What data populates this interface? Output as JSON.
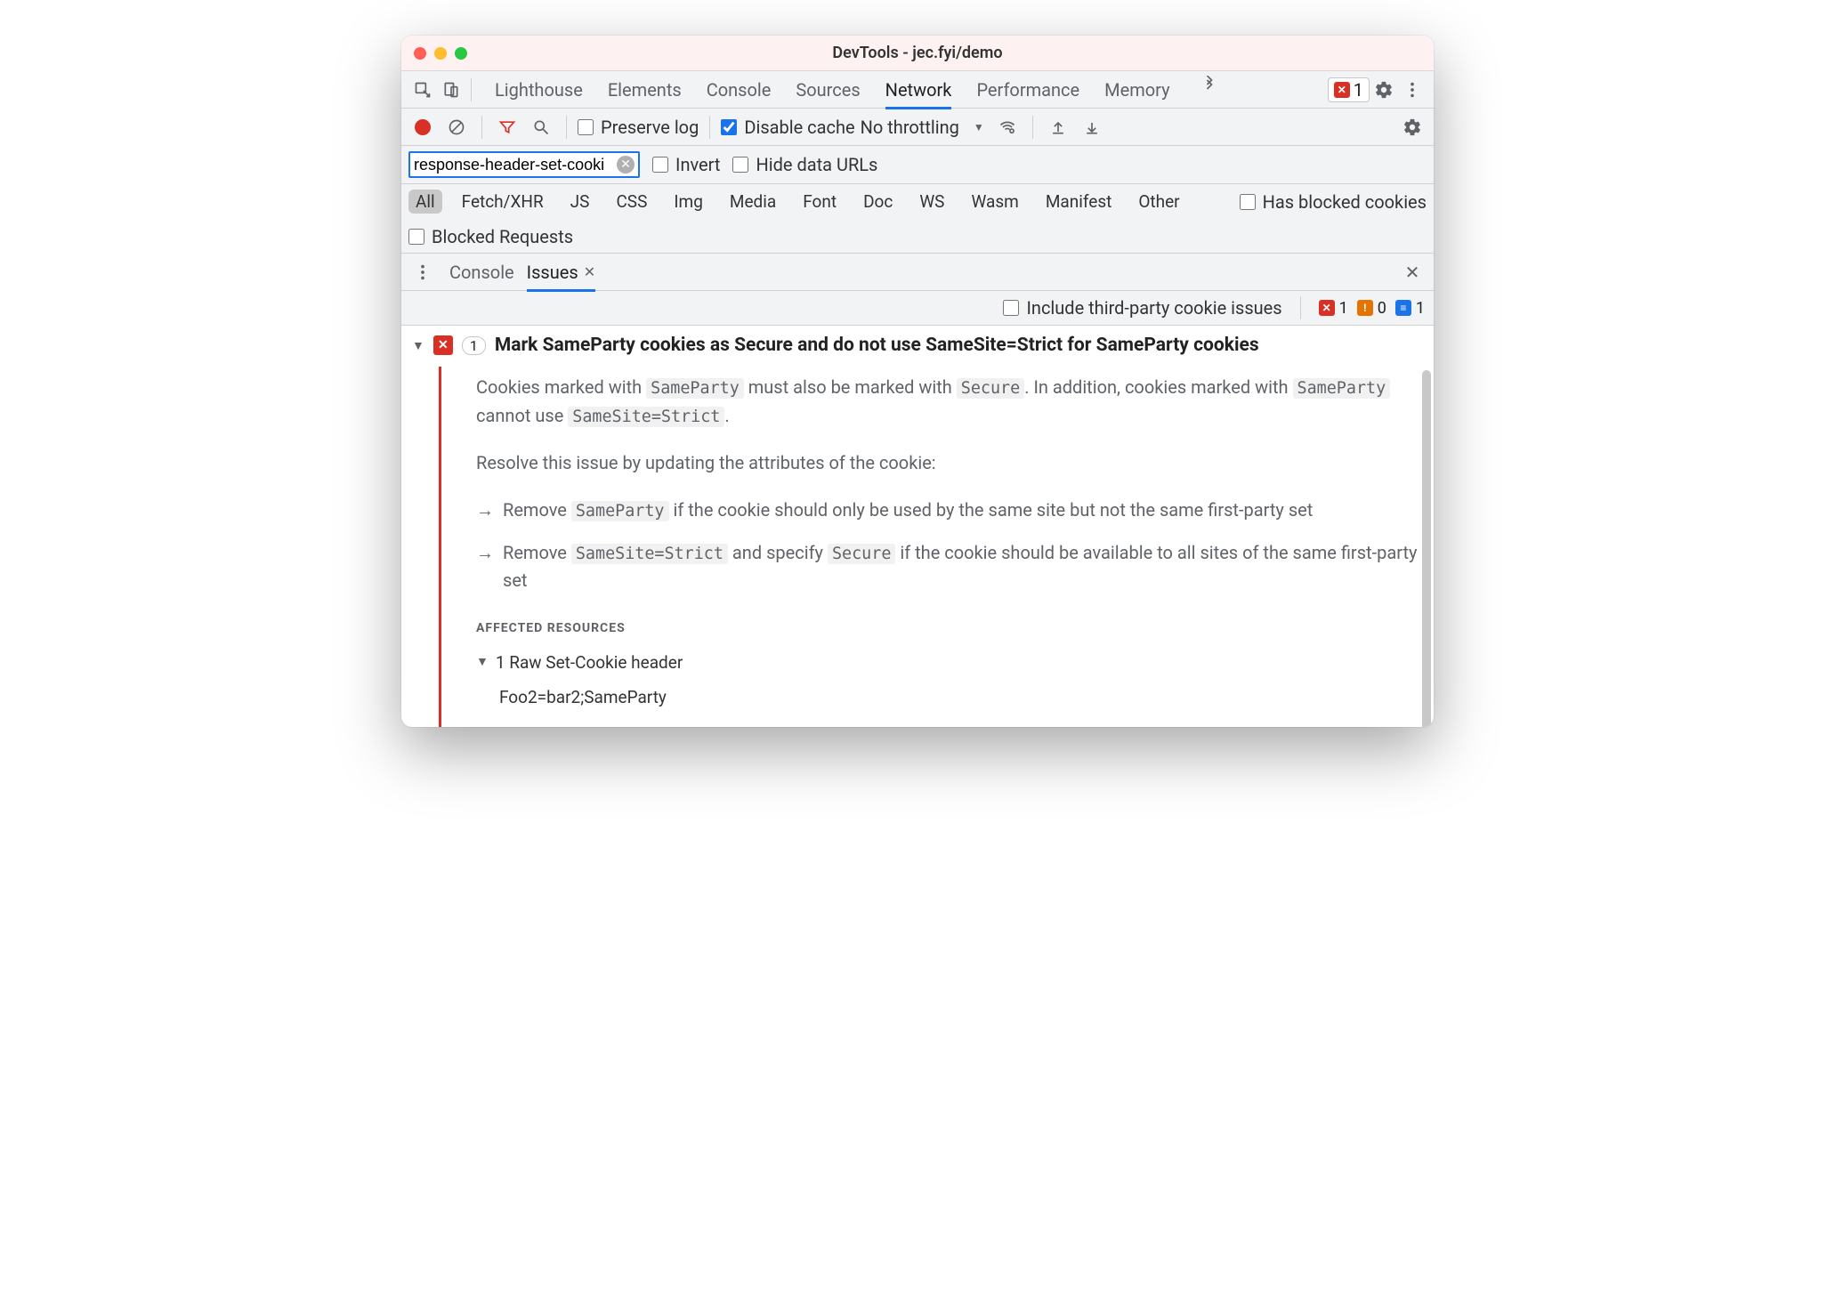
{
  "window": {
    "title": "DevTools - jec.fyi/demo"
  },
  "tabs": {
    "items": [
      "Lighthouse",
      "Elements",
      "Console",
      "Sources",
      "Network",
      "Performance",
      "Memory"
    ],
    "active": "Network",
    "error_count": "1"
  },
  "network_toolbar": {
    "preserve_log": "Preserve log",
    "disable_cache": "Disable cache",
    "throttling": "No throttling"
  },
  "filter": {
    "value": "response-header-set-cooki",
    "invert": "Invert",
    "hide_data_urls": "Hide data URLs"
  },
  "types": {
    "items": [
      "All",
      "Fetch/XHR",
      "JS",
      "CSS",
      "Img",
      "Media",
      "Font",
      "Doc",
      "WS",
      "Wasm",
      "Manifest",
      "Other"
    ],
    "active": "All",
    "has_blocked": "Has blocked cookies",
    "blocked_requests": "Blocked Requests"
  },
  "drawer": {
    "tabs": [
      "Console",
      "Issues"
    ],
    "active": "Issues"
  },
  "issues_bar": {
    "include_third_party": "Include third-party cookie issues",
    "counts": {
      "error": "1",
      "warn": "0",
      "info": "1"
    }
  },
  "issue": {
    "count": "1",
    "title": "Mark SameParty cookies as Secure and do not use SameSite=Strict for SameParty cookies",
    "p1_a": "Cookies marked with ",
    "p1_code1": "SameParty",
    "p1_b": " must also be marked with ",
    "p1_code2": "Secure",
    "p1_c": ". In addition, cookies marked with ",
    "p1_code3": "SameParty",
    "p1_d": " cannot use ",
    "p1_code4": "SameSite=Strict",
    "p1_e": ".",
    "p2": "Resolve this issue by updating the attributes of the cookie:",
    "b1_a": "Remove ",
    "b1_code": "SameParty",
    "b1_b": " if the cookie should only be used by the same site but not the same first-party set",
    "b2_a": "Remove ",
    "b2_code1": "SameSite=Strict",
    "b2_b": " and specify ",
    "b2_code2": "Secure",
    "b2_c": " if the cookie should be available to all sites of the same first-party set",
    "affected_hdr": "AFFECTED RESOURCES",
    "affected_row": "1 Raw Set-Cookie header",
    "affected_value": "Foo2=bar2;SameParty"
  }
}
